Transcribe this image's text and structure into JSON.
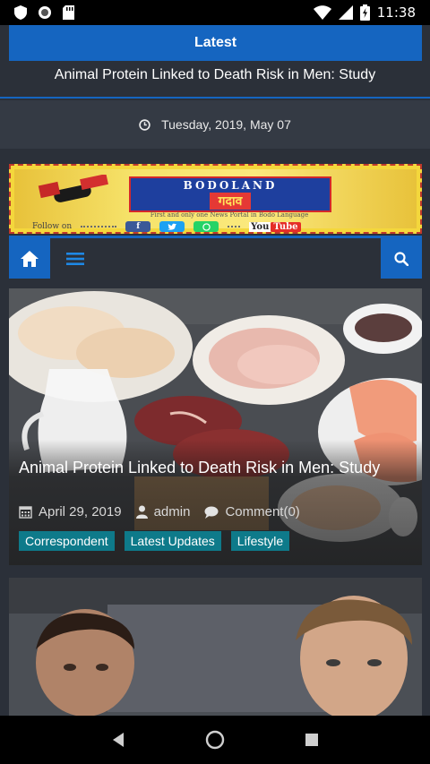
{
  "status_bar": {
    "time": "11:38"
  },
  "latest": {
    "label": "Latest",
    "ticker": "Animal Protein Linked to Death Risk in Men: Study"
  },
  "date": {
    "text": "Tuesday, 2019, May 07"
  },
  "banner": {
    "title": "BODOLAND",
    "subtitle": "गदाव",
    "tagline": "First and only one News Portal in Bodo Language",
    "follow": "Follow on",
    "youtube_you": "You",
    "youtube_tube": "Tube",
    "colors": {
      "background": "#f4d73c",
      "box": "#1e3f9e",
      "accent": "#e53935"
    }
  },
  "navbar": {
    "accent": "#1565c0"
  },
  "articles": [
    {
      "title": "Animal Protein Linked to Death Risk in Men: Study",
      "date": "April 29, 2019",
      "author": "admin",
      "comments": "Comment(0)",
      "tags": [
        "Correspondent",
        "Latest Updates",
        "Lifestyle"
      ]
    },
    {
      "title": "",
      "image": "two men portrait still"
    }
  ],
  "icons": {
    "home": "home-icon",
    "menu": "menu-icon",
    "search": "search-icon",
    "calendar": "calendar-icon",
    "user": "user-icon",
    "comment": "comment-icon",
    "clock": "clock-icon"
  }
}
